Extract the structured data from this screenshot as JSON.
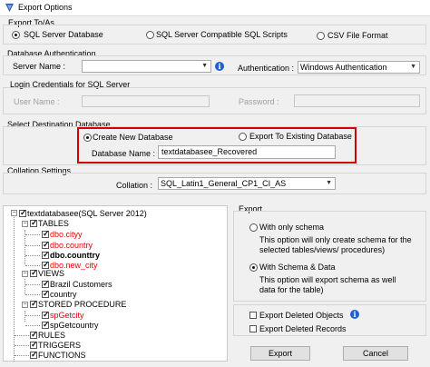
{
  "window": {
    "title": "Export Options"
  },
  "export_to": {
    "legend": "Export To/As",
    "options": [
      "SQL Server Database",
      "SQL Server Compatible SQL Scripts",
      "CSV File Format"
    ],
    "selected": "SQL Server Database"
  },
  "db_auth": {
    "legend": "Database Authentication",
    "server_label": "Server Name :",
    "server_value": "",
    "auth_label": "Authentication :",
    "auth_value": "Windows Authentication"
  },
  "credentials": {
    "legend": "Login Credentials for SQL Server",
    "user_label": "User Name :",
    "password_label": "Password :"
  },
  "destination": {
    "legend": "Select Destination Database",
    "create_new": "Create New Database",
    "export_existing": "Export To Existing Database",
    "selected": "Create New Database",
    "db_name_label": "Database Name :",
    "db_name_value": "textdatabasee_Recovered"
  },
  "collation": {
    "legend": "Collation Settings",
    "label": "Collation :",
    "value": "SQL_Latin1_General_CP1_CI_AS"
  },
  "tree": {
    "root": "textdatabasee(SQL Server 2012)",
    "tables_label": "TABLES",
    "tables": [
      "dbo.cityy",
      "dbo.country",
      "dbo.counttry",
      "dbo.new_city"
    ],
    "views_label": "VIEWS",
    "views": [
      "Brazil Customers",
      "country"
    ],
    "procedures_label": "STORED PROCEDURE",
    "procedures": [
      "spGetcity",
      "spGetcountry"
    ],
    "rules_label": "RULES",
    "triggers_label": "TRIGGERS",
    "functions_label": "FUNCTIONS"
  },
  "export": {
    "legend": "Export",
    "schema_only": "With only schema",
    "schema_only_desc": "This option will only create schema for the  selected tables/views/ procedures)",
    "schema_data": "With Schema & Data",
    "schema_data_desc": "This option will export schema as well data for the table)",
    "selected": "With Schema & Data"
  },
  "deleted": {
    "objects": "Export Deleted Objects",
    "records": "Export Deleted Records"
  },
  "buttons": {
    "export": "Export",
    "cancel": "Cancel"
  }
}
